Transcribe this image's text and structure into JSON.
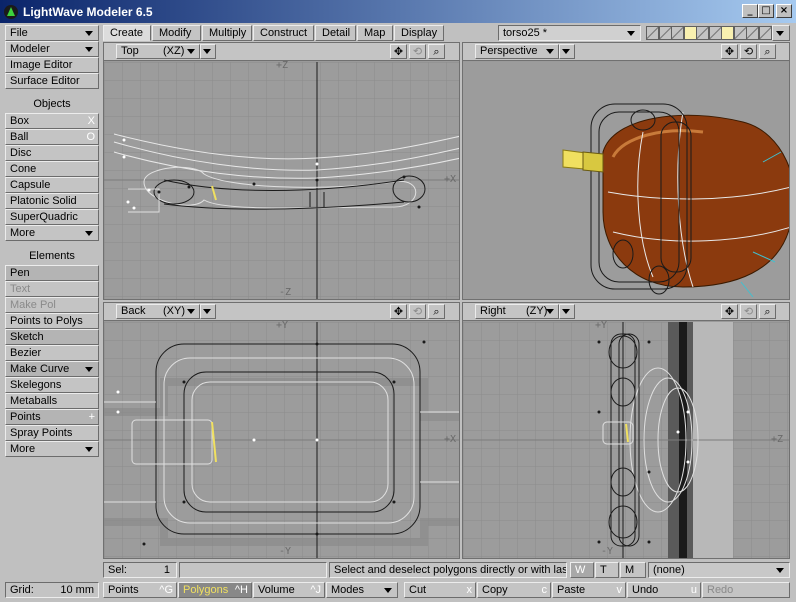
{
  "window": {
    "title": "LightWave Modeler 6.5",
    "minimize": "_",
    "maximize": "□",
    "close": "×"
  },
  "tabs": [
    "Create",
    "Modify",
    "Multiply",
    "Construct",
    "Detail",
    "Map",
    "Display"
  ],
  "layer_select": "torso25 *",
  "sidebar": {
    "file": "File",
    "modeler": "Modeler",
    "image_editor": "Image Editor",
    "surface_editor": "Surface Editor",
    "objects_header": "Objects",
    "objects": [
      {
        "label": "Box",
        "shortcut": "X"
      },
      {
        "label": "Ball",
        "shortcut": "O"
      },
      {
        "label": "Disc",
        "shortcut": ""
      },
      {
        "label": "Cone",
        "shortcut": ""
      },
      {
        "label": "Capsule",
        "shortcut": ""
      },
      {
        "label": "Platonic Solid",
        "shortcut": ""
      },
      {
        "label": "SuperQuadric",
        "shortcut": ""
      },
      {
        "label": "More",
        "shortcut": ""
      }
    ],
    "elements_header": "Elements",
    "elements": [
      {
        "label": "Pen",
        "shortcut": ""
      },
      {
        "label": "Text",
        "shortcut": ""
      },
      {
        "label": "Make Pol",
        "shortcut": ""
      },
      {
        "label": "Points to Polys",
        "shortcut": ""
      },
      {
        "label": "Sketch",
        "shortcut": ""
      },
      {
        "label": "Bezier",
        "shortcut": ""
      },
      {
        "label": "Make Curve",
        "shortcut": ""
      },
      {
        "label": "Skelegons",
        "shortcut": ""
      },
      {
        "label": "Metaballs",
        "shortcut": ""
      },
      {
        "label": "Points",
        "shortcut": "+"
      },
      {
        "label": "Spray Points",
        "shortcut": ""
      },
      {
        "label": "More",
        "shortcut": ""
      }
    ],
    "grid_label": "Grid:",
    "grid_value": "10 mm"
  },
  "viewports": [
    {
      "name": "Top",
      "axes": "(XZ)",
      "axis_labels": {
        "top": "+Z",
        "right": "+X",
        "bottom": "-Z"
      }
    },
    {
      "name": "Perspective",
      "axes": ""
    },
    {
      "name": "Back",
      "axes": "(XY)",
      "axis_labels": {
        "top": "+Y",
        "right": "+X",
        "bottom": "-Y"
      }
    },
    {
      "name": "Right",
      "axes": "(ZY)",
      "axis_labels": {
        "top": "+Y",
        "right": "+Z",
        "bottom": "-Y"
      }
    }
  ],
  "viewport_icons": {
    "move": "move-icon",
    "rotate": "rotate-icon",
    "zoom": "zoom-icon"
  },
  "status": {
    "sel_label": "Sel:",
    "sel_value": "1",
    "hint": "Select and deselect polygons directly or with las...",
    "wtm": [
      "W",
      "T",
      "M"
    ],
    "surface": "(none)"
  },
  "bottom_bar": {
    "points": "Points",
    "points_key": "^G",
    "polygons": "Polygons",
    "polygons_key": "^H",
    "volume": "Volume",
    "volume_key": "^J",
    "modes": "Modes",
    "cut": "Cut",
    "cut_key": "x",
    "copy": "Copy",
    "copy_key": "c",
    "paste": "Paste",
    "paste_key": "v",
    "undo": "Undo",
    "undo_key": "u",
    "redo": "Redo"
  },
  "colors": {
    "title_start": "#0a246a",
    "title_end": "#a6caf0",
    "body": "#8b3a0e",
    "selection": "#f0e060"
  }
}
